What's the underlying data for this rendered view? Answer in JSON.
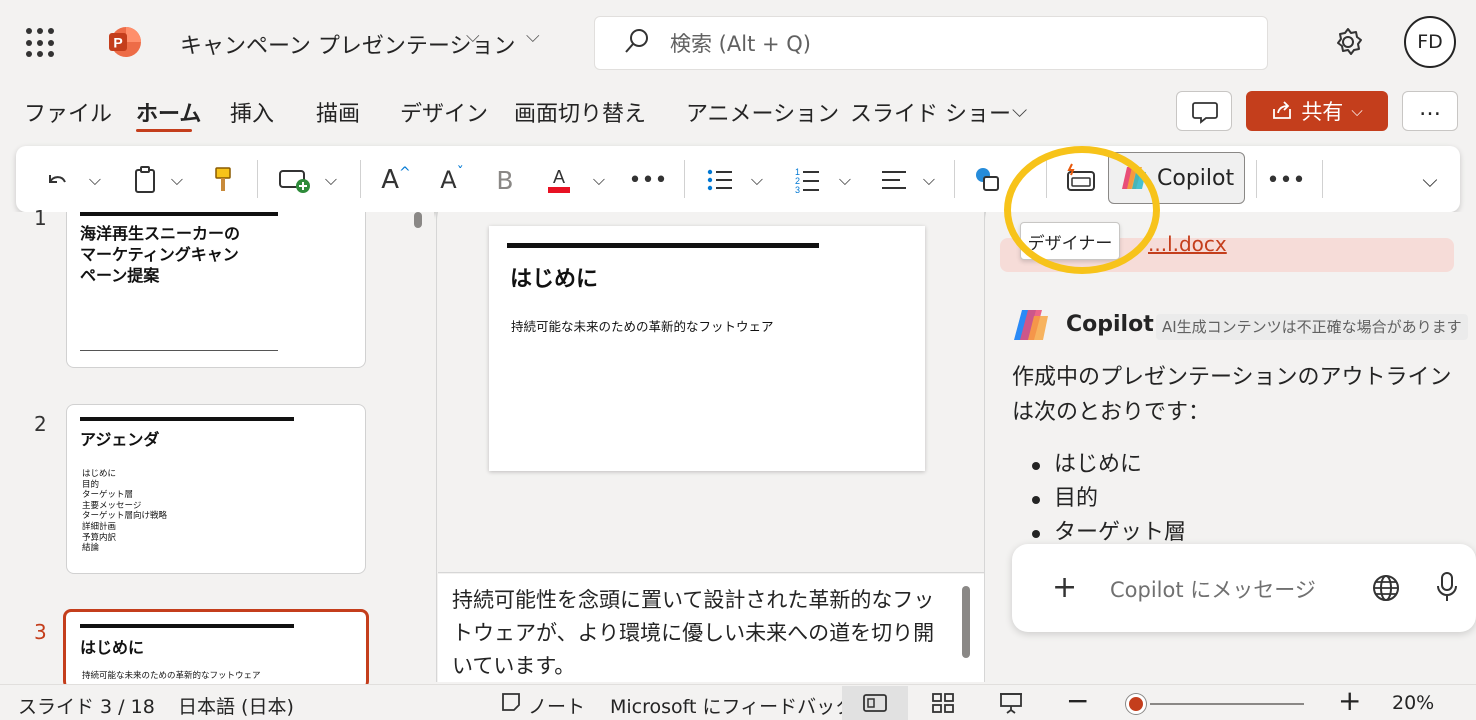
{
  "app": {
    "doc_title": "キャンペーン プレゼンテーション",
    "search_placeholder": "検索 (Alt + Q)",
    "user_initials": "FD"
  },
  "tabs": [
    "ファイル",
    "ホーム",
    "挿入",
    "描画",
    "デザイン",
    "画面切り替え",
    "アニメーション",
    "スライド ショー"
  ],
  "share_label": "共有",
  "more_label": "…",
  "ribbon": {
    "copilot_label": "Copilot",
    "tooltip": "デザイナー"
  },
  "thumbnails": [
    {
      "num": "1",
      "title": "海洋再生スニーカーの\nマーケティングキャン\nペーン提案",
      "body": ""
    },
    {
      "num": "2",
      "title": "アジェンダ",
      "body": "はじめに\n目的\nターゲット層\n主要メッセージ\nターゲット層向け戦略\n詳細計画\n予算内訳\n結論"
    },
    {
      "num": "3",
      "title": "はじめに",
      "body": "持続可能な未来のための革新的なフットウェア"
    }
  ],
  "slide": {
    "title": "はじめに",
    "body": "持続可能な未来のための革新的なフットウェア"
  },
  "notes": "持続可能性を念頭に置いて設計された革新的なフットウェアが、より環境に優しい未来への道を切り開いています。",
  "copilot": {
    "file_link": "...l.docx",
    "name": "Copilot",
    "disclaimer": "AI生成コンテンツは不正確な場合があります",
    "message": "作成中のプレゼンテーションのアウトラインは次のとおりです：",
    "outline": [
      "はじめに",
      "目的",
      "ターゲット層"
    ],
    "input_placeholder": "Copilot にメッセージ"
  },
  "status": {
    "slide": "スライド 3 / 18",
    "language": "日本語 (日本)",
    "notes": "ノート",
    "feedback": "Microsoft にフィードバック",
    "zoom": "20%"
  },
  "colors": {
    "accent": "#c43e1c",
    "highlight": "#f7c31a"
  }
}
